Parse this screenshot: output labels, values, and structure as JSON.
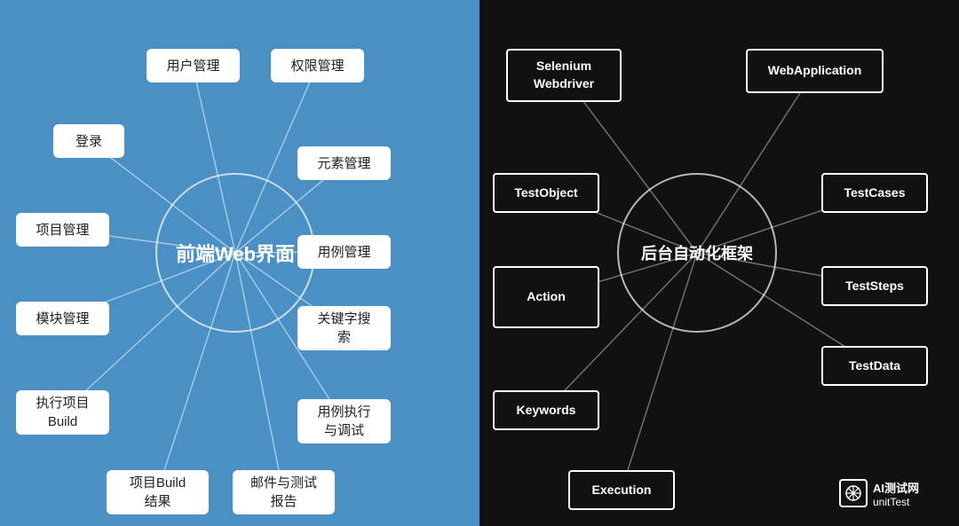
{
  "left_panel": {
    "background": "#4a90c4",
    "circle_label": "前端Web界面",
    "nodes": [
      {
        "id": "user-mgmt",
        "label": "用户管理"
      },
      {
        "id": "perm-mgmt",
        "label": "权限管理"
      },
      {
        "id": "login",
        "label": "登录"
      },
      {
        "id": "elem-mgmt",
        "label": "元素管理"
      },
      {
        "id": "proj-mgmt",
        "label": "项目管理"
      },
      {
        "id": "case-mgmt",
        "label": "用例管理"
      },
      {
        "id": "module-mgmt",
        "label": "模块管理"
      },
      {
        "id": "keyword-search",
        "label": "关键字搜\n索"
      },
      {
        "id": "exec-build",
        "label": "执行项目\nBuild"
      },
      {
        "id": "case-exec",
        "label": "用例执行\n与调试"
      },
      {
        "id": "build-result",
        "label": "项目Build\n结果"
      },
      {
        "id": "email-report",
        "label": "邮件与测试\n报告"
      }
    ]
  },
  "right_panel": {
    "background": "#111111",
    "circle_label": "后台自动化框架",
    "nodes": [
      {
        "id": "selenium",
        "label": "Selenium\nWebdriver"
      },
      {
        "id": "webapp",
        "label": "WebApplication"
      },
      {
        "id": "testobj",
        "label": "TestObject"
      },
      {
        "id": "testcases",
        "label": "TestCases"
      },
      {
        "id": "action",
        "label": "Action"
      },
      {
        "id": "teststeps",
        "label": "TestSteps"
      },
      {
        "id": "testdata",
        "label": "TestData"
      },
      {
        "id": "keywords",
        "label": "Keywords"
      },
      {
        "id": "execution",
        "label": "Execution"
      }
    ]
  },
  "logo": {
    "text": "AI测试网\nunitTest",
    "icon": "✳"
  }
}
